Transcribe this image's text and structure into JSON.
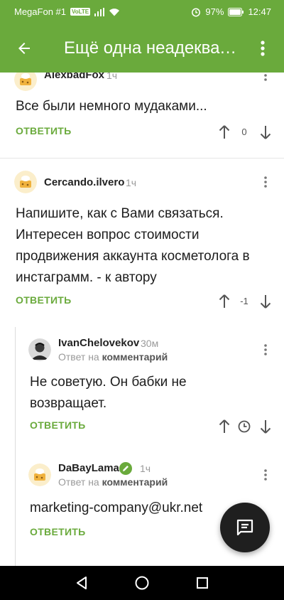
{
  "status": {
    "carrier": "MegaFon #1",
    "volte": "VoLTE",
    "battery": "97%",
    "time": "12:47"
  },
  "appbar": {
    "title": "Ещё одна неадекватная..."
  },
  "comments": [
    {
      "author": "AlexbadFox",
      "time": "1ч",
      "text": "Все были немного мудаками...",
      "reply_label": "ОТВЕТИТЬ",
      "score": "0"
    },
    {
      "author": "Cercando.ilvero",
      "time": "1ч",
      "text": "Напишите, как с Вами связаться. Интересен вопрос стоимости продвижения аккаунта косметолога в инстаграмм. - к автору",
      "reply_label": "ОТВЕТИТЬ",
      "score": "-1"
    },
    {
      "author": "IvanChelovekov",
      "time": "30м",
      "reply_prefix": "Ответ на",
      "reply_target": "комментарий",
      "text": "Не советую. Он бабки не возвращает.",
      "reply_label": "ОТВЕТИТЬ"
    },
    {
      "author": "DaBayLama",
      "time": "1ч",
      "reply_prefix": "Ответ на",
      "reply_target": "комментарий",
      "text": "marketing-company@ukr.net",
      "reply_label": "ОТВЕТИТЬ"
    }
  ],
  "colors": {
    "accent": "#6aaa3c",
    "fab": "#1f1f1f"
  },
  "icons": {
    "back": "arrow-left-icon",
    "more": "more-vert-icon",
    "upvote": "arrow-up-icon",
    "downvote": "arrow-down-icon",
    "pending": "clock-icon",
    "compose": "message-icon",
    "verified": "pencil-badge-icon"
  }
}
